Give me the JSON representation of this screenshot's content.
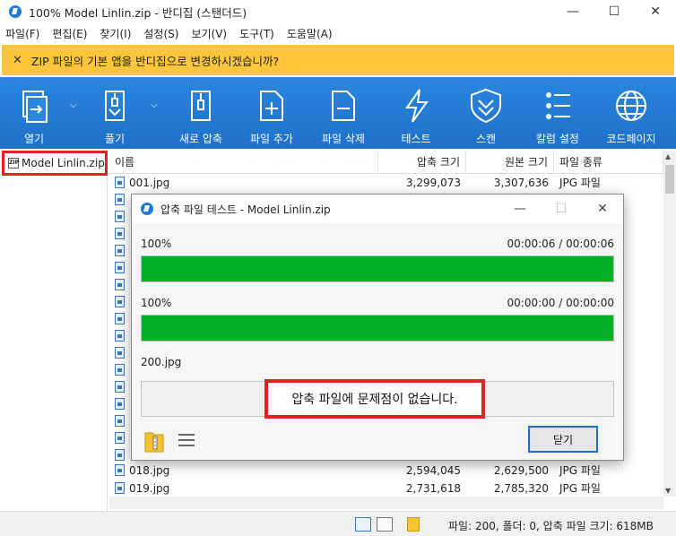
{
  "window": {
    "title": "100% Model Linlin.zip - 반디집 (스탠더드)",
    "controls": [
      "—",
      "☐",
      "✕"
    ]
  },
  "menu": [
    "파일(F)",
    "편집(E)",
    "찾기(I)",
    "설정(S)",
    "보기(V)",
    "도구(T)",
    "도움말(A)"
  ],
  "notice": {
    "close": "✕",
    "text": "ZIP 파일의 기본 앱을 반디집으로 변경하시겠습니까?",
    "color": "#fdc63a"
  },
  "toolbar": [
    {
      "label": "열기",
      "icon": "open-icon"
    },
    {
      "label": "풀기",
      "icon": "extract-icon"
    },
    {
      "label": "새로 압축",
      "icon": "new-archive-icon"
    },
    {
      "label": "파일 추가",
      "icon": "add-file-icon"
    },
    {
      "label": "파일 삭제",
      "icon": "delete-file-icon"
    },
    {
      "label": "테스트",
      "icon": "test-icon"
    },
    {
      "label": "스캔",
      "icon": "scan-icon"
    },
    {
      "label": "칼럼 설정",
      "icon": "column-settings-icon"
    },
    {
      "label": "코드페이지",
      "icon": "codepage-icon"
    }
  ],
  "tree": {
    "archive": "Model Linlin.zip"
  },
  "columns": {
    "name": "이름",
    "compressed": "압축 크기",
    "original": "원본 크기",
    "type": "파일 종류"
  },
  "files_top": [
    {
      "name": "001.jpg",
      "compressed": "3,299,073",
      "original": "3,307,636",
      "type": "JPG 파일"
    }
  ],
  "files_bottom": [
    {
      "name": "018.jpg",
      "compressed": "2,594,045",
      "original": "2,629,500",
      "type": "JPG 파일"
    },
    {
      "name": "019.jpg",
      "compressed": "2,731,618",
      "original": "2,785,320",
      "type": "JPG 파일"
    }
  ],
  "status": {
    "text": "파일: 200, 폴더: 0, 압축 파일 크기: 618MB"
  },
  "dialog": {
    "title": "압축 파일 테스트 - Model Linlin.zip",
    "controls": [
      "—",
      "☐",
      "✕"
    ],
    "total": {
      "percent": "100%",
      "time": "00:00:06 / 00:00:06",
      "progress": 1.0
    },
    "current": {
      "percent": "100%",
      "time": "00:00:00 / 00:00:00",
      "progress": 1.0
    },
    "current_file": "200.jpg",
    "message": "압축 파일에 문제점이 없습니다.",
    "close_label": "닫기",
    "progress_color": "#06b025"
  }
}
